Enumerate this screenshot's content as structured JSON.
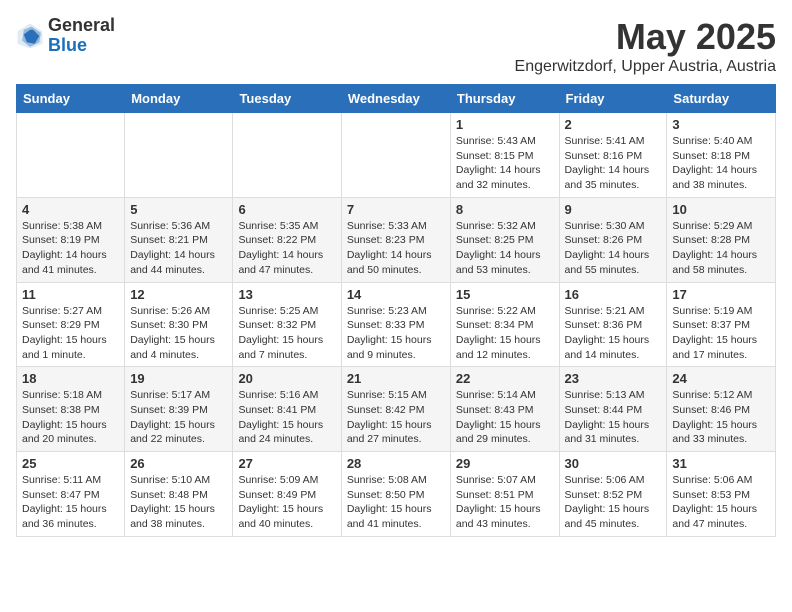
{
  "header": {
    "logo_general": "General",
    "logo_blue": "Blue",
    "month_title": "May 2025",
    "location": "Engerwitzdorf, Upper Austria, Austria"
  },
  "weekdays": [
    "Sunday",
    "Monday",
    "Tuesday",
    "Wednesday",
    "Thursday",
    "Friday",
    "Saturday"
  ],
  "weeks": [
    [
      {
        "day": "",
        "info": ""
      },
      {
        "day": "",
        "info": ""
      },
      {
        "day": "",
        "info": ""
      },
      {
        "day": "",
        "info": ""
      },
      {
        "day": "1",
        "info": "Sunrise: 5:43 AM\nSunset: 8:15 PM\nDaylight: 14 hours\nand 32 minutes."
      },
      {
        "day": "2",
        "info": "Sunrise: 5:41 AM\nSunset: 8:16 PM\nDaylight: 14 hours\nand 35 minutes."
      },
      {
        "day": "3",
        "info": "Sunrise: 5:40 AM\nSunset: 8:18 PM\nDaylight: 14 hours\nand 38 minutes."
      }
    ],
    [
      {
        "day": "4",
        "info": "Sunrise: 5:38 AM\nSunset: 8:19 PM\nDaylight: 14 hours\nand 41 minutes."
      },
      {
        "day": "5",
        "info": "Sunrise: 5:36 AM\nSunset: 8:21 PM\nDaylight: 14 hours\nand 44 minutes."
      },
      {
        "day": "6",
        "info": "Sunrise: 5:35 AM\nSunset: 8:22 PM\nDaylight: 14 hours\nand 47 minutes."
      },
      {
        "day": "7",
        "info": "Sunrise: 5:33 AM\nSunset: 8:23 PM\nDaylight: 14 hours\nand 50 minutes."
      },
      {
        "day": "8",
        "info": "Sunrise: 5:32 AM\nSunset: 8:25 PM\nDaylight: 14 hours\nand 53 minutes."
      },
      {
        "day": "9",
        "info": "Sunrise: 5:30 AM\nSunset: 8:26 PM\nDaylight: 14 hours\nand 55 minutes."
      },
      {
        "day": "10",
        "info": "Sunrise: 5:29 AM\nSunset: 8:28 PM\nDaylight: 14 hours\nand 58 minutes."
      }
    ],
    [
      {
        "day": "11",
        "info": "Sunrise: 5:27 AM\nSunset: 8:29 PM\nDaylight: 15 hours\nand 1 minute."
      },
      {
        "day": "12",
        "info": "Sunrise: 5:26 AM\nSunset: 8:30 PM\nDaylight: 15 hours\nand 4 minutes."
      },
      {
        "day": "13",
        "info": "Sunrise: 5:25 AM\nSunset: 8:32 PM\nDaylight: 15 hours\nand 7 minutes."
      },
      {
        "day": "14",
        "info": "Sunrise: 5:23 AM\nSunset: 8:33 PM\nDaylight: 15 hours\nand 9 minutes."
      },
      {
        "day": "15",
        "info": "Sunrise: 5:22 AM\nSunset: 8:34 PM\nDaylight: 15 hours\nand 12 minutes."
      },
      {
        "day": "16",
        "info": "Sunrise: 5:21 AM\nSunset: 8:36 PM\nDaylight: 15 hours\nand 14 minutes."
      },
      {
        "day": "17",
        "info": "Sunrise: 5:19 AM\nSunset: 8:37 PM\nDaylight: 15 hours\nand 17 minutes."
      }
    ],
    [
      {
        "day": "18",
        "info": "Sunrise: 5:18 AM\nSunset: 8:38 PM\nDaylight: 15 hours\nand 20 minutes."
      },
      {
        "day": "19",
        "info": "Sunrise: 5:17 AM\nSunset: 8:39 PM\nDaylight: 15 hours\nand 22 minutes."
      },
      {
        "day": "20",
        "info": "Sunrise: 5:16 AM\nSunset: 8:41 PM\nDaylight: 15 hours\nand 24 minutes."
      },
      {
        "day": "21",
        "info": "Sunrise: 5:15 AM\nSunset: 8:42 PM\nDaylight: 15 hours\nand 27 minutes."
      },
      {
        "day": "22",
        "info": "Sunrise: 5:14 AM\nSunset: 8:43 PM\nDaylight: 15 hours\nand 29 minutes."
      },
      {
        "day": "23",
        "info": "Sunrise: 5:13 AM\nSunset: 8:44 PM\nDaylight: 15 hours\nand 31 minutes."
      },
      {
        "day": "24",
        "info": "Sunrise: 5:12 AM\nSunset: 8:46 PM\nDaylight: 15 hours\nand 33 minutes."
      }
    ],
    [
      {
        "day": "25",
        "info": "Sunrise: 5:11 AM\nSunset: 8:47 PM\nDaylight: 15 hours\nand 36 minutes."
      },
      {
        "day": "26",
        "info": "Sunrise: 5:10 AM\nSunset: 8:48 PM\nDaylight: 15 hours\nand 38 minutes."
      },
      {
        "day": "27",
        "info": "Sunrise: 5:09 AM\nSunset: 8:49 PM\nDaylight: 15 hours\nand 40 minutes."
      },
      {
        "day": "28",
        "info": "Sunrise: 5:08 AM\nSunset: 8:50 PM\nDaylight: 15 hours\nand 41 minutes."
      },
      {
        "day": "29",
        "info": "Sunrise: 5:07 AM\nSunset: 8:51 PM\nDaylight: 15 hours\nand 43 minutes."
      },
      {
        "day": "30",
        "info": "Sunrise: 5:06 AM\nSunset: 8:52 PM\nDaylight: 15 hours\nand 45 minutes."
      },
      {
        "day": "31",
        "info": "Sunrise: 5:06 AM\nSunset: 8:53 PM\nDaylight: 15 hours\nand 47 minutes."
      }
    ]
  ]
}
